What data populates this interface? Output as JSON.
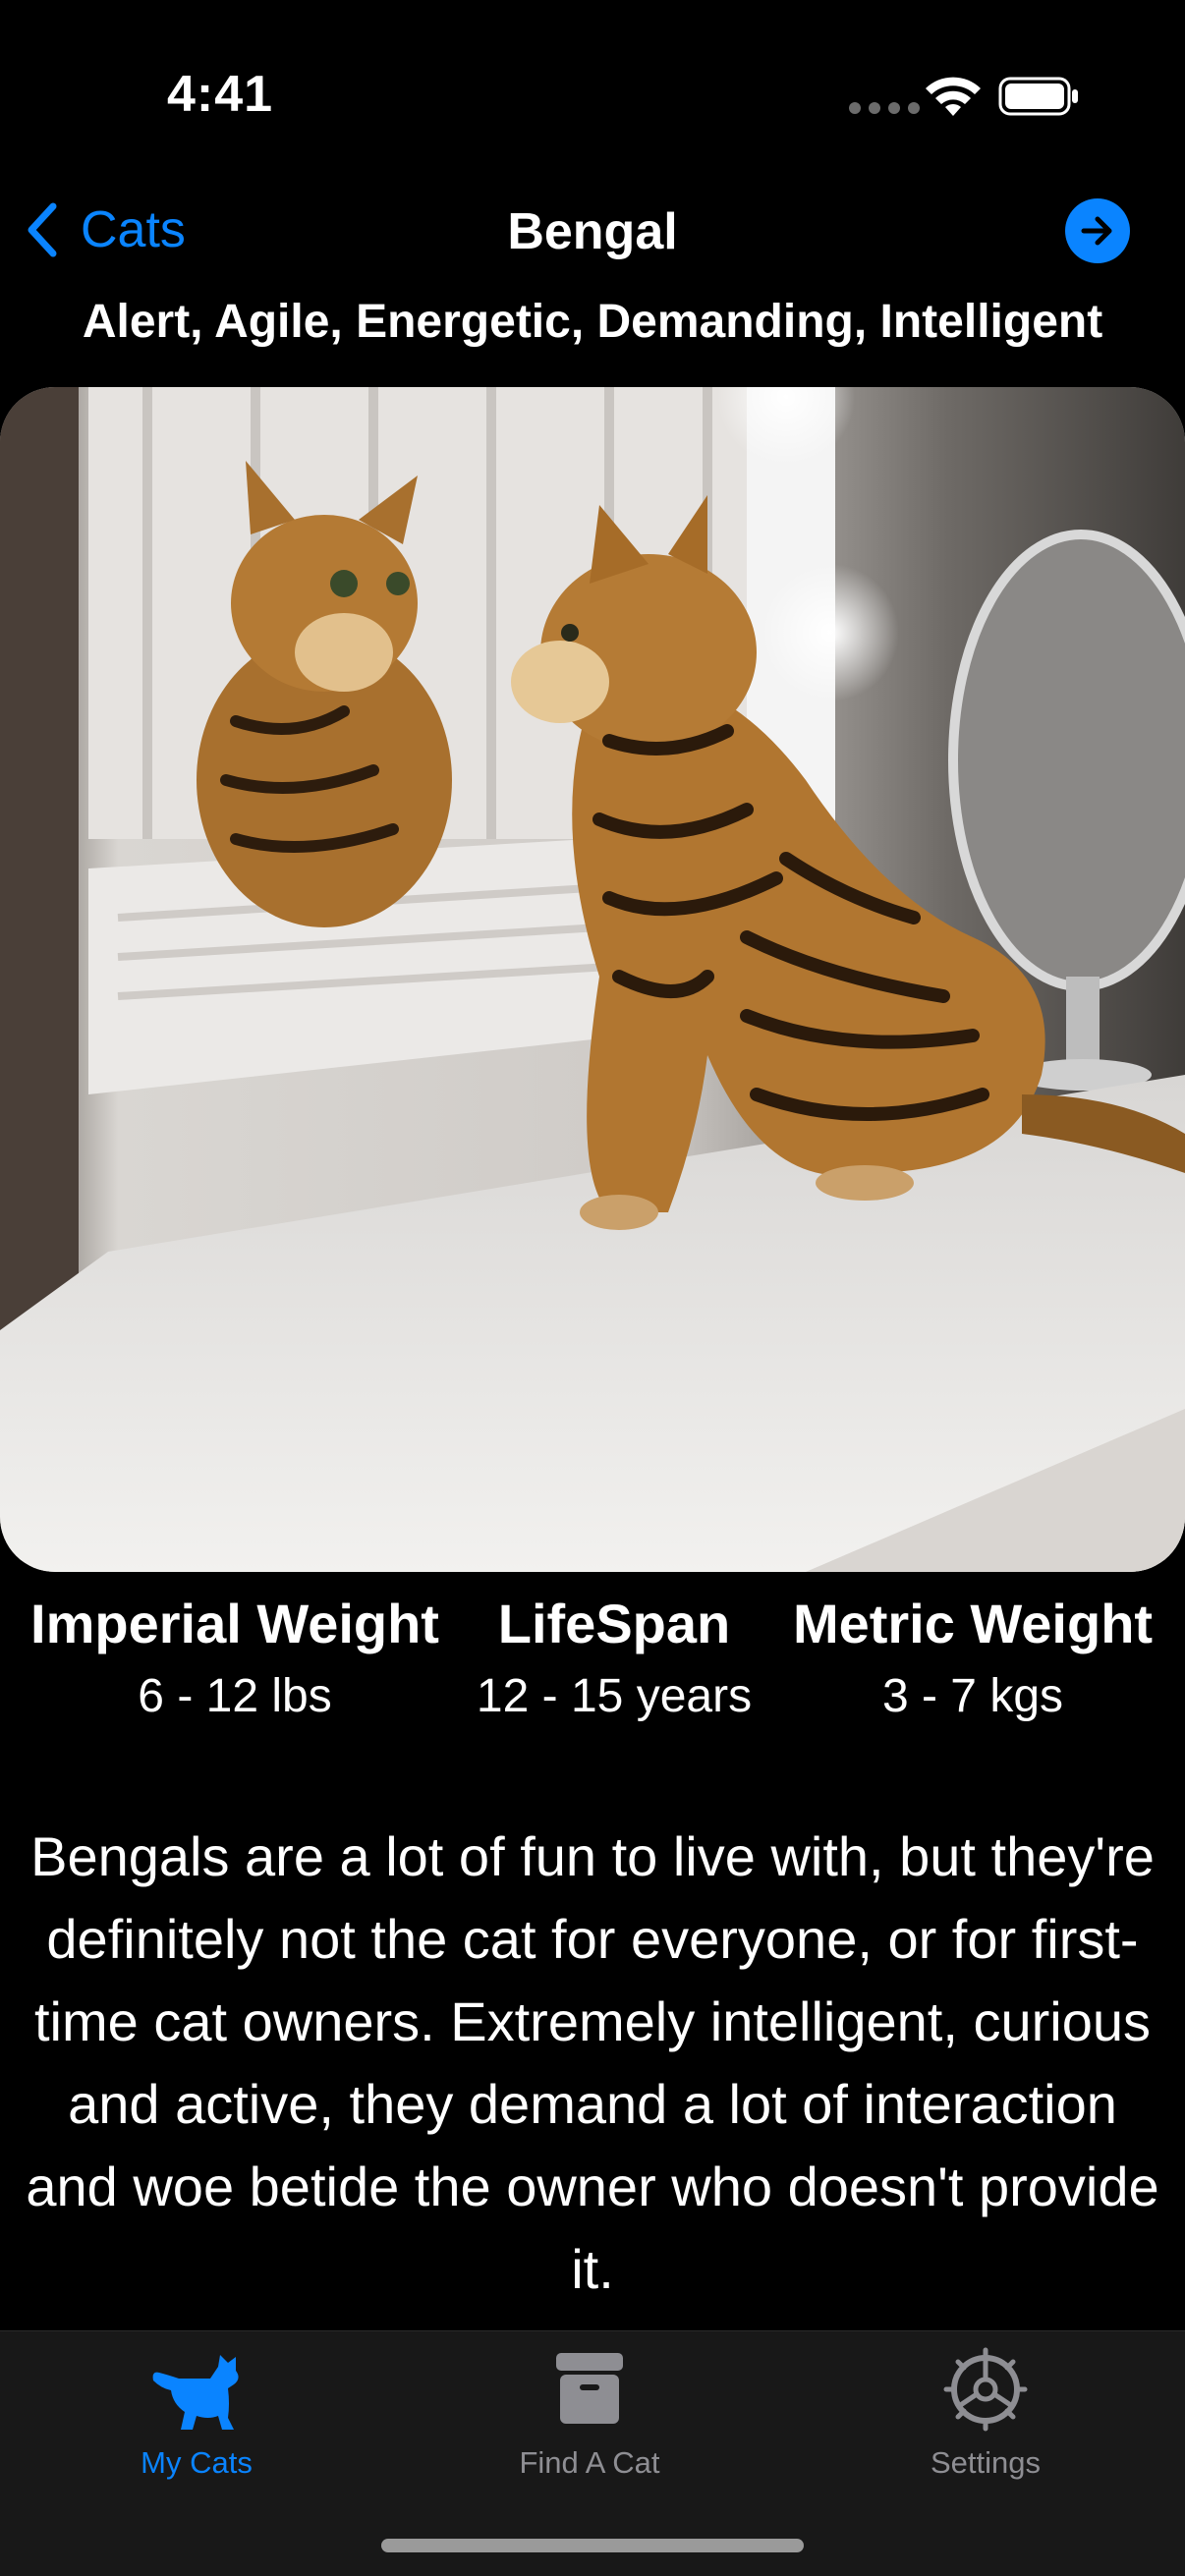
{
  "status_bar": {
    "time": "4:41"
  },
  "nav": {
    "back_label": "Cats",
    "title": "Bengal"
  },
  "temperament": "Alert, Agile, Energetic, Demanding, Intelligent",
  "stats": {
    "imperial_label": "Imperial Weight",
    "imperial_value": "6 - 12 lbs",
    "lifespan_label": "LifeSpan",
    "lifespan_value": "12 - 15 years",
    "metric_label": "Metric Weight",
    "metric_value": "3 - 7 kgs"
  },
  "description": "Bengals are a lot of fun to live with, but they're definitely not the cat for everyone, or for first-time cat owners. Extremely intelligent, curious and active, they demand a lot of interaction and woe betide the owner who doesn't provide it.",
  "tab_bar": {
    "tabs": [
      {
        "label": "My Cats",
        "icon": "cat-icon",
        "selected": true
      },
      {
        "label": "Find A Cat",
        "icon": "archive-box-icon",
        "selected": false
      },
      {
        "label": "Settings",
        "icon": "gear-icon",
        "selected": false
      }
    ]
  },
  "colors": {
    "accent": "#0a84ff",
    "background": "#000000",
    "tab_bar_bg": "#181818",
    "inactive_tab": "#8e8e93"
  }
}
